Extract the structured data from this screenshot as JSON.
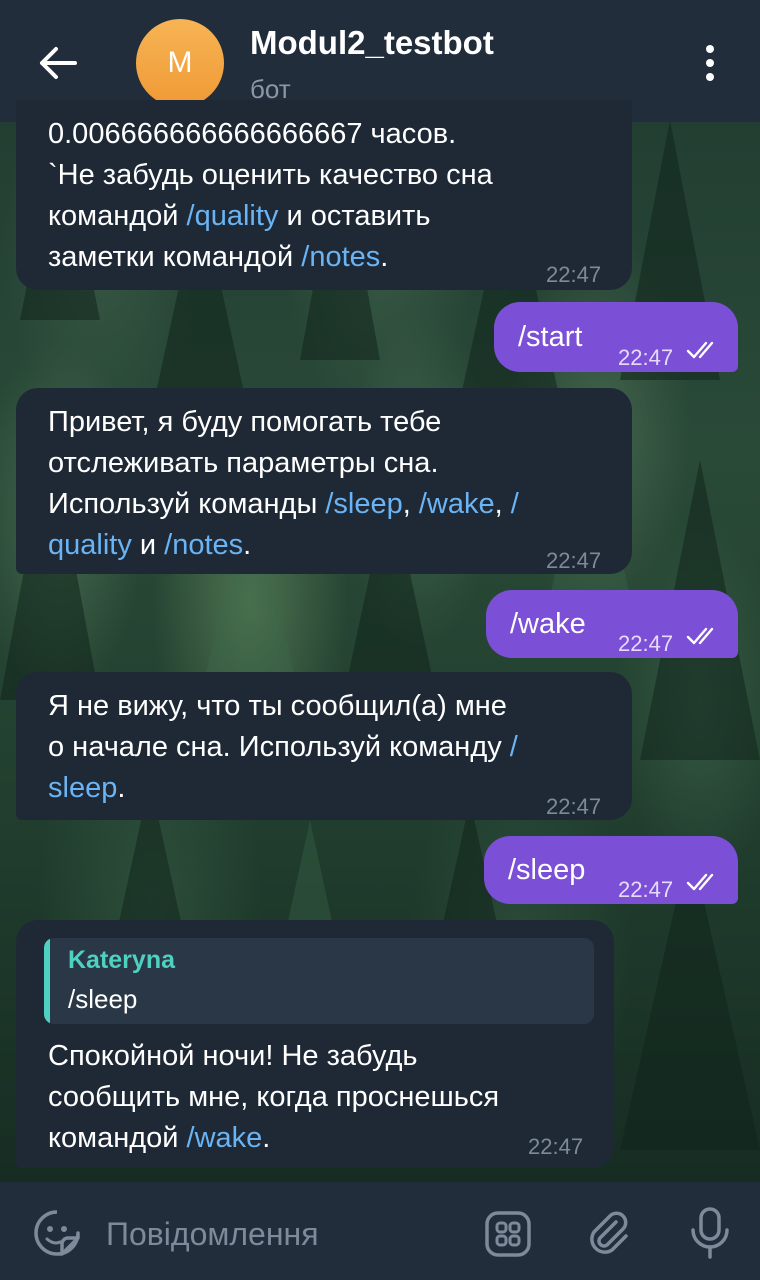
{
  "header": {
    "avatar_letter": "M",
    "title": "Modul2_testbot",
    "subtitle": "бот"
  },
  "messages": {
    "m1": {
      "line1": "0.006666666666666667 часов.",
      "line2": "`Не забудь оценить качество сна",
      "line3_a": "командой ",
      "line3_link": "/quality",
      "line3_b": " и оставить",
      "line4_a": "заметки командой ",
      "line4_link": "/notes",
      "line4_b": ".",
      "time": "22:47"
    },
    "m2": {
      "text": "/start",
      "time": "22:47"
    },
    "m3": {
      "line1": "Привет, я буду помогать тебе",
      "line2": "отслеживать параметры сна.",
      "line3_a": "Используй команды ",
      "line3_link1": "/sleep",
      "line3_b": ", ",
      "line3_link2": "/wake",
      "line3_c": ", ",
      "line3_link3": "/",
      "line4_link": "quality",
      "line4_a": " и ",
      "line4_link2": "/notes",
      "line4_b": ".",
      "time": "22:47"
    },
    "m4": {
      "text": "/wake",
      "time": "22:47"
    },
    "m5": {
      "line1": "Я не вижу, что ты сообщил(а) мне",
      "line2_a": "о начале сна. Используй команду ",
      "line2_link": "/",
      "line3_link": "sleep",
      "line3_b": ".",
      "time": "22:47"
    },
    "m6": {
      "text": "/sleep",
      "time": "22:47"
    },
    "m7": {
      "reply_name": "Kateryna",
      "reply_text": "/sleep",
      "line1": "Спокойной ночи! Не забудь",
      "line2": "сообщить мне, когда проснешься",
      "line3_a": "командой ",
      "line3_link": "/wake",
      "line3_b": ".",
      "time": "22:47"
    }
  },
  "input": {
    "placeholder": "Повідомлення"
  },
  "colors": {
    "header_bg": "#212d3b",
    "incoming_bubble": "#1e2935",
    "outgoing_bubble": "#7b4fd6",
    "link": "#6ab4f5",
    "reply_accent": "#4fd1c2",
    "avatar": "#f2a23e"
  },
  "icons": {
    "back": "arrow-left-icon",
    "menu": "more-vert-icon",
    "emoji": "sticker-emoji-icon",
    "commands": "bot-commands-icon",
    "attach": "paperclip-icon",
    "mic": "microphone-icon",
    "read": "double-check-icon"
  }
}
